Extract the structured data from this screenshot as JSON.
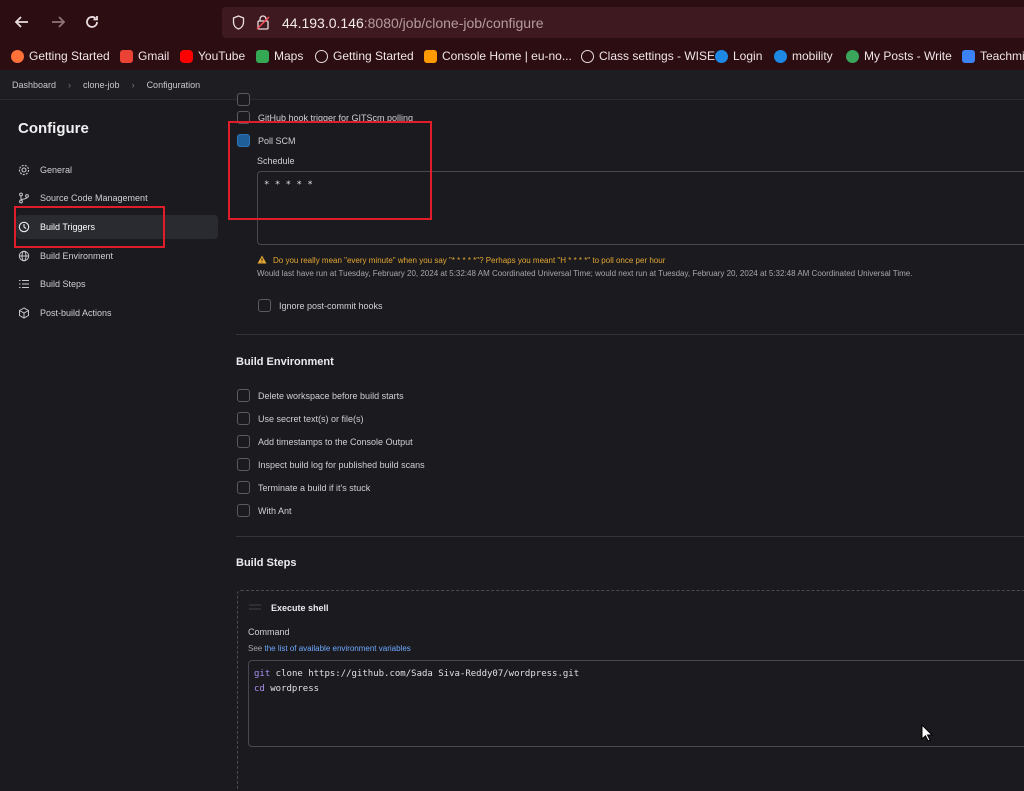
{
  "browser": {
    "url_host": "44.193.0.146",
    "url_path": ":8080/job/clone-job/configure",
    "bookmarks": [
      {
        "label": "Getting Started",
        "color": "#ff7139"
      },
      {
        "label": "Gmail",
        "color": "#ea4335"
      },
      {
        "label": "YouTube",
        "color": "#ff0000"
      },
      {
        "label": "Maps",
        "color": "#34a853"
      },
      {
        "label": "Getting Started",
        "color": "#e9dcdf"
      },
      {
        "label": "Console Home | eu-no...",
        "color": "#ff9900"
      },
      {
        "label": "Class settings - WISE",
        "color": "#e9dcdf"
      },
      {
        "label": "Login",
        "color": "#1e88e5"
      },
      {
        "label": "mobility",
        "color": "#1e88e5"
      },
      {
        "label": "My Posts - Write",
        "color": "#3ba55c"
      },
      {
        "label": "Teachmi",
        "color": "#3b82f6"
      }
    ]
  },
  "breadcrumb": [
    "Dashboard",
    "clone-job",
    "Configuration"
  ],
  "sidebar": {
    "title": "Configure",
    "items": [
      {
        "label": "General",
        "icon": "gear-icon"
      },
      {
        "label": "Source Code Management",
        "icon": "branch-icon"
      },
      {
        "label": "Build Triggers",
        "icon": "clock-icon",
        "active": true
      },
      {
        "label": "Build Environment",
        "icon": "globe-icon"
      },
      {
        "label": "Build Steps",
        "icon": "list-icon"
      },
      {
        "label": "Post-build Actions",
        "icon": "box-icon"
      }
    ]
  },
  "triggers": {
    "github_hook": "GitHub hook trigger for GITScm polling",
    "poll_scm": "Poll SCM",
    "schedule_label": "Schedule",
    "schedule_value": "* * * * *",
    "warning": "Do you really mean \"every minute\" when you say \"* * * * *\"? Perhaps you meant \"H * * * *\" to poll once per hour",
    "info": "Would last have run at Tuesday, February 20, 2024 at 5:32:48 AM Coordinated Universal Time; would next run at Tuesday, February 20, 2024 at 5:32:48 AM Coordinated Universal Time.",
    "ignore_hooks": "Ignore post-commit hooks"
  },
  "build_environment": {
    "title": "Build Environment",
    "options": [
      "Delete workspace before build starts",
      "Use secret text(s) or file(s)",
      "Add timestamps to the Console Output",
      "Inspect build log for published build scans",
      "Terminate a build if it's stuck",
      "With Ant"
    ]
  },
  "build_steps": {
    "title": "Build Steps",
    "step_title": "Execute shell",
    "command_label": "Command",
    "see_prefix": "See ",
    "see_link": "the list of available environment variables",
    "command_lines": [
      {
        "kw": "git",
        "rest": " clone https://github.com/Sada Siva-Reddy07/wordpress.git"
      },
      {
        "kw": "cd",
        "rest": " wordpress"
      }
    ]
  }
}
